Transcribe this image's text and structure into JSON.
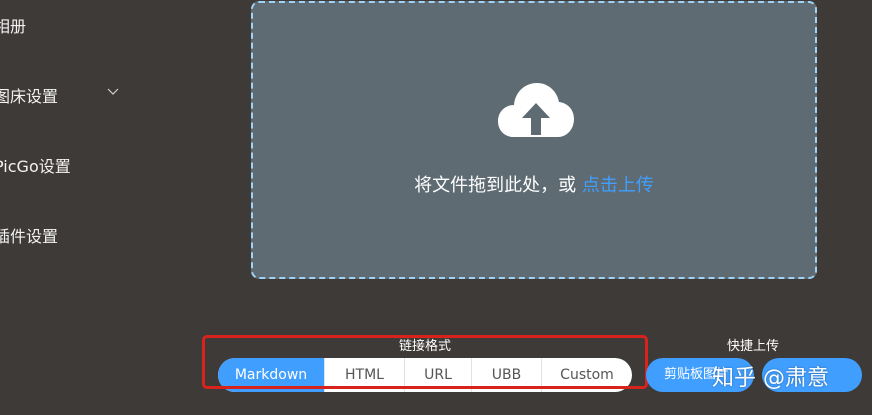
{
  "sidebar": {
    "items": [
      {
        "label": "相册"
      },
      {
        "label": "图床设置",
        "icon": "chevron-down-icon"
      },
      {
        "label": "PicGo设置"
      },
      {
        "label": "插件设置"
      }
    ]
  },
  "upload": {
    "icon": "cloud-upload-icon",
    "hint_text": "将文件拖到此处，或 ",
    "hint_link": "点击上传"
  },
  "link_format": {
    "title": "链接格式",
    "options": [
      "Markdown",
      "HTML",
      "URL",
      "UBB",
      "Custom"
    ],
    "selected": "Markdown"
  },
  "quick_upload": {
    "title": "快捷上传",
    "clipboard_button": "剪贴板图片"
  },
  "watermark": "知乎 @肃意",
  "colors": {
    "background": "#3e3a37",
    "accent": "#409eff",
    "upload_bg": "#5e6b72",
    "upload_border": "#9fd2f5",
    "highlight": "#d8231d"
  }
}
